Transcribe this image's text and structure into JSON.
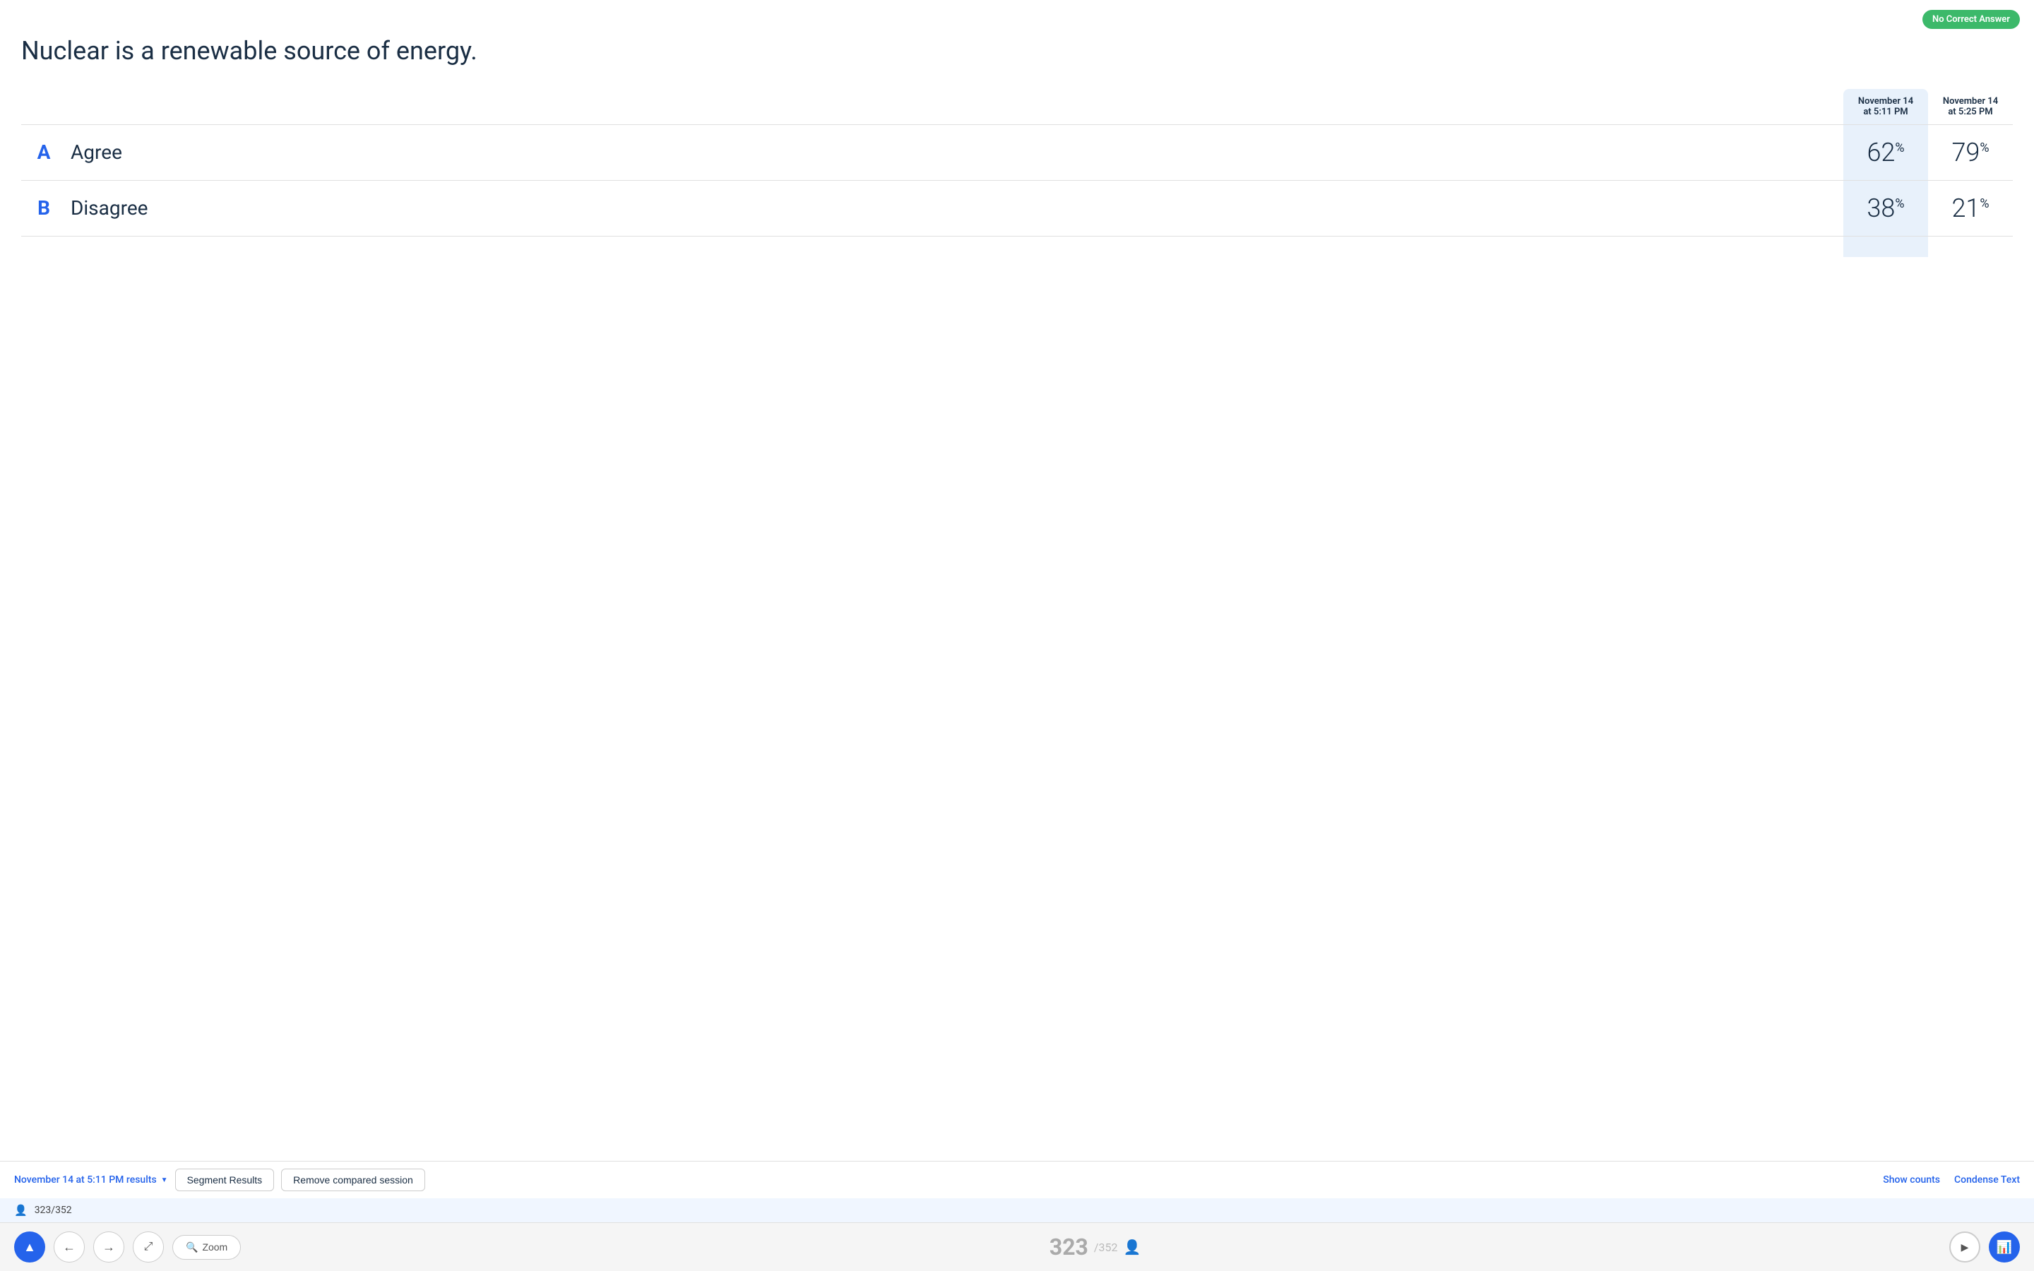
{
  "badge": {
    "label": "No Correct Answer",
    "color": "#3cb96a"
  },
  "question": {
    "title": "Nuclear is a renewable source of energy."
  },
  "sessions": {
    "session1": {
      "label": "November 14 at 5:11 PM",
      "highlighted": true
    },
    "session2": {
      "label": "November 14 at 5:25 PM",
      "highlighted": false
    }
  },
  "answers": [
    {
      "letter": "A",
      "text": "Agree",
      "pct1": "62",
      "pct2": "79"
    },
    {
      "letter": "B",
      "text": "Disagree",
      "pct1": "38",
      "pct2": "21"
    }
  ],
  "toolbar": {
    "session_dropdown_label": "November 14 at 5:11 PM results",
    "segment_btn": "Segment Results",
    "remove_btn": "Remove compared session",
    "show_counts": "Show counts",
    "condense_text": "Condense Text"
  },
  "count_bar": {
    "count": "323/352"
  },
  "action_bar": {
    "up_icon": "▲",
    "back_icon": "←",
    "forward_icon": "→",
    "move_icon": "⤢",
    "zoom_label": "Zoom",
    "count_big": "323",
    "count_small": "/352",
    "play_icon": "▶",
    "chart_icon": "📊"
  }
}
